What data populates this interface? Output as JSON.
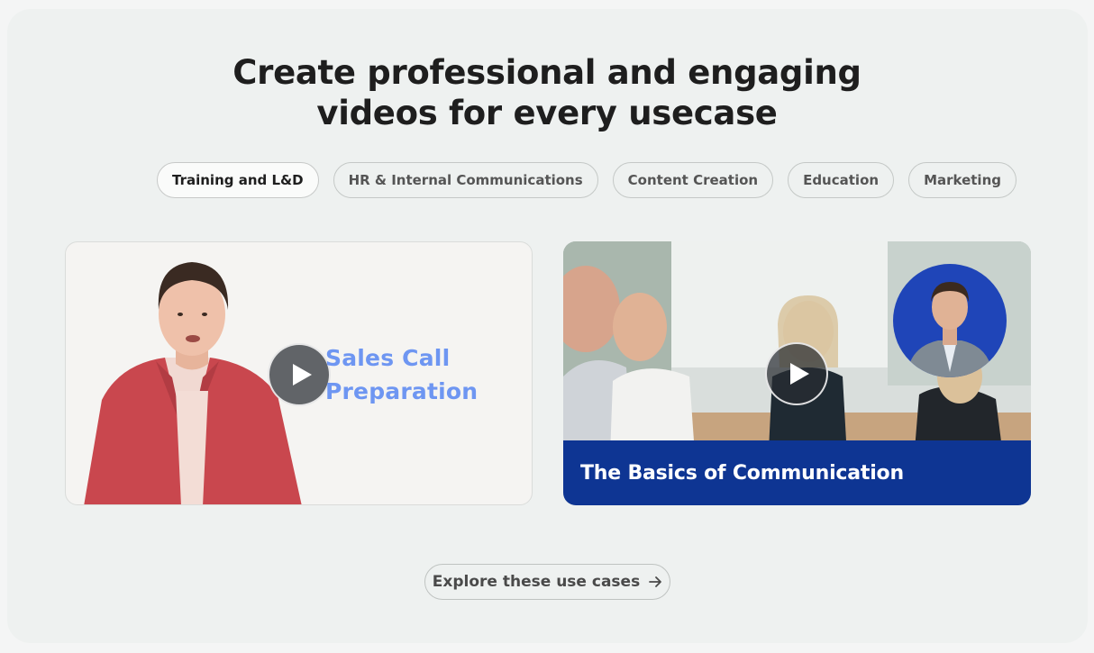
{
  "heading": {
    "line1": "Create professional and engaging",
    "line2": "videos for every usecase"
  },
  "tabs": [
    {
      "label": "Training and L&D",
      "active": true
    },
    {
      "label": "HR & Internal Communications",
      "active": false
    },
    {
      "label": "Content Creation",
      "active": false
    },
    {
      "label": "Education",
      "active": false
    },
    {
      "label": "Marketing",
      "active": false
    }
  ],
  "videos": [
    {
      "title_line1": "Sales Call",
      "title_line2": "Preparation",
      "title_color": "#6e96f2"
    },
    {
      "caption": "The Basics of Communication",
      "caption_bg": "#0e3593"
    }
  ],
  "cta": {
    "label": "Explore these use cases",
    "icon": "arrow-right-icon"
  },
  "colors": {
    "panel_bg": "#eef1f0",
    "accent_blue": "#0e3593"
  }
}
